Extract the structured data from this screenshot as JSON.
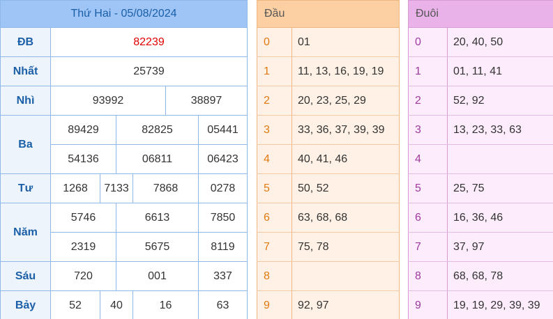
{
  "results": {
    "title": "Thứ Hai - 05/08/2024",
    "prizes": {
      "db": {
        "label": "ĐB",
        "numbers": [
          "82239"
        ]
      },
      "nhat": {
        "label": "Nhất",
        "numbers": [
          "25739"
        ]
      },
      "nhi": {
        "label": "Nhì",
        "numbers": [
          "93992",
          "38897"
        ]
      },
      "ba": {
        "label": "Ba",
        "numbers": [
          "89429",
          "82825",
          "05441",
          "54136",
          "06811",
          "06423"
        ]
      },
      "tu": {
        "label": "Tư",
        "numbers": [
          "1268",
          "7133",
          "7868",
          "0278"
        ]
      },
      "nam": {
        "label": "Năm",
        "numbers": [
          "5746",
          "6613",
          "7850",
          "2319",
          "5675",
          "8119"
        ]
      },
      "sau": {
        "label": "Sáu",
        "numbers": [
          "720",
          "001",
          "337"
        ]
      },
      "bay": {
        "label": "Bảy",
        "numbers": [
          "52",
          "40",
          "16",
          "63"
        ]
      }
    }
  },
  "head": {
    "title": "Đầu",
    "rows": [
      {
        "digit": "0",
        "values": "01"
      },
      {
        "digit": "1",
        "values": "11, 13, 16, 19, 19"
      },
      {
        "digit": "2",
        "values": "20, 23, 25, 29"
      },
      {
        "digit": "3",
        "values": "33, 36, 37, 39, 39"
      },
      {
        "digit": "4",
        "values": "40, 41, 46"
      },
      {
        "digit": "5",
        "values": "50, 52"
      },
      {
        "digit": "6",
        "values": "63, 68, 68"
      },
      {
        "digit": "7",
        "values": "75, 78"
      },
      {
        "digit": "8",
        "values": ""
      },
      {
        "digit": "9",
        "values": "92, 97"
      }
    ]
  },
  "tail": {
    "title": "Đuôi",
    "rows": [
      {
        "digit": "0",
        "values": "20, 40, 50"
      },
      {
        "digit": "1",
        "values": "01, 11, 41"
      },
      {
        "digit": "2",
        "values": "52, 92"
      },
      {
        "digit": "3",
        "values": "13, 23, 33, 63"
      },
      {
        "digit": "4",
        "values": ""
      },
      {
        "digit": "5",
        "values": "25, 75"
      },
      {
        "digit": "6",
        "values": "16, 36, 46"
      },
      {
        "digit": "7",
        "values": "37, 97"
      },
      {
        "digit": "8",
        "values": "68, 68, 78"
      },
      {
        "digit": "9",
        "values": "19, 19, 29, 39, 39"
      }
    ]
  },
  "colors": {
    "header_blue": "#9ec5f5",
    "special_prize_red": "#e00000",
    "head_orange": "#fdd0a3",
    "tail_purple": "#e9b3e9"
  }
}
